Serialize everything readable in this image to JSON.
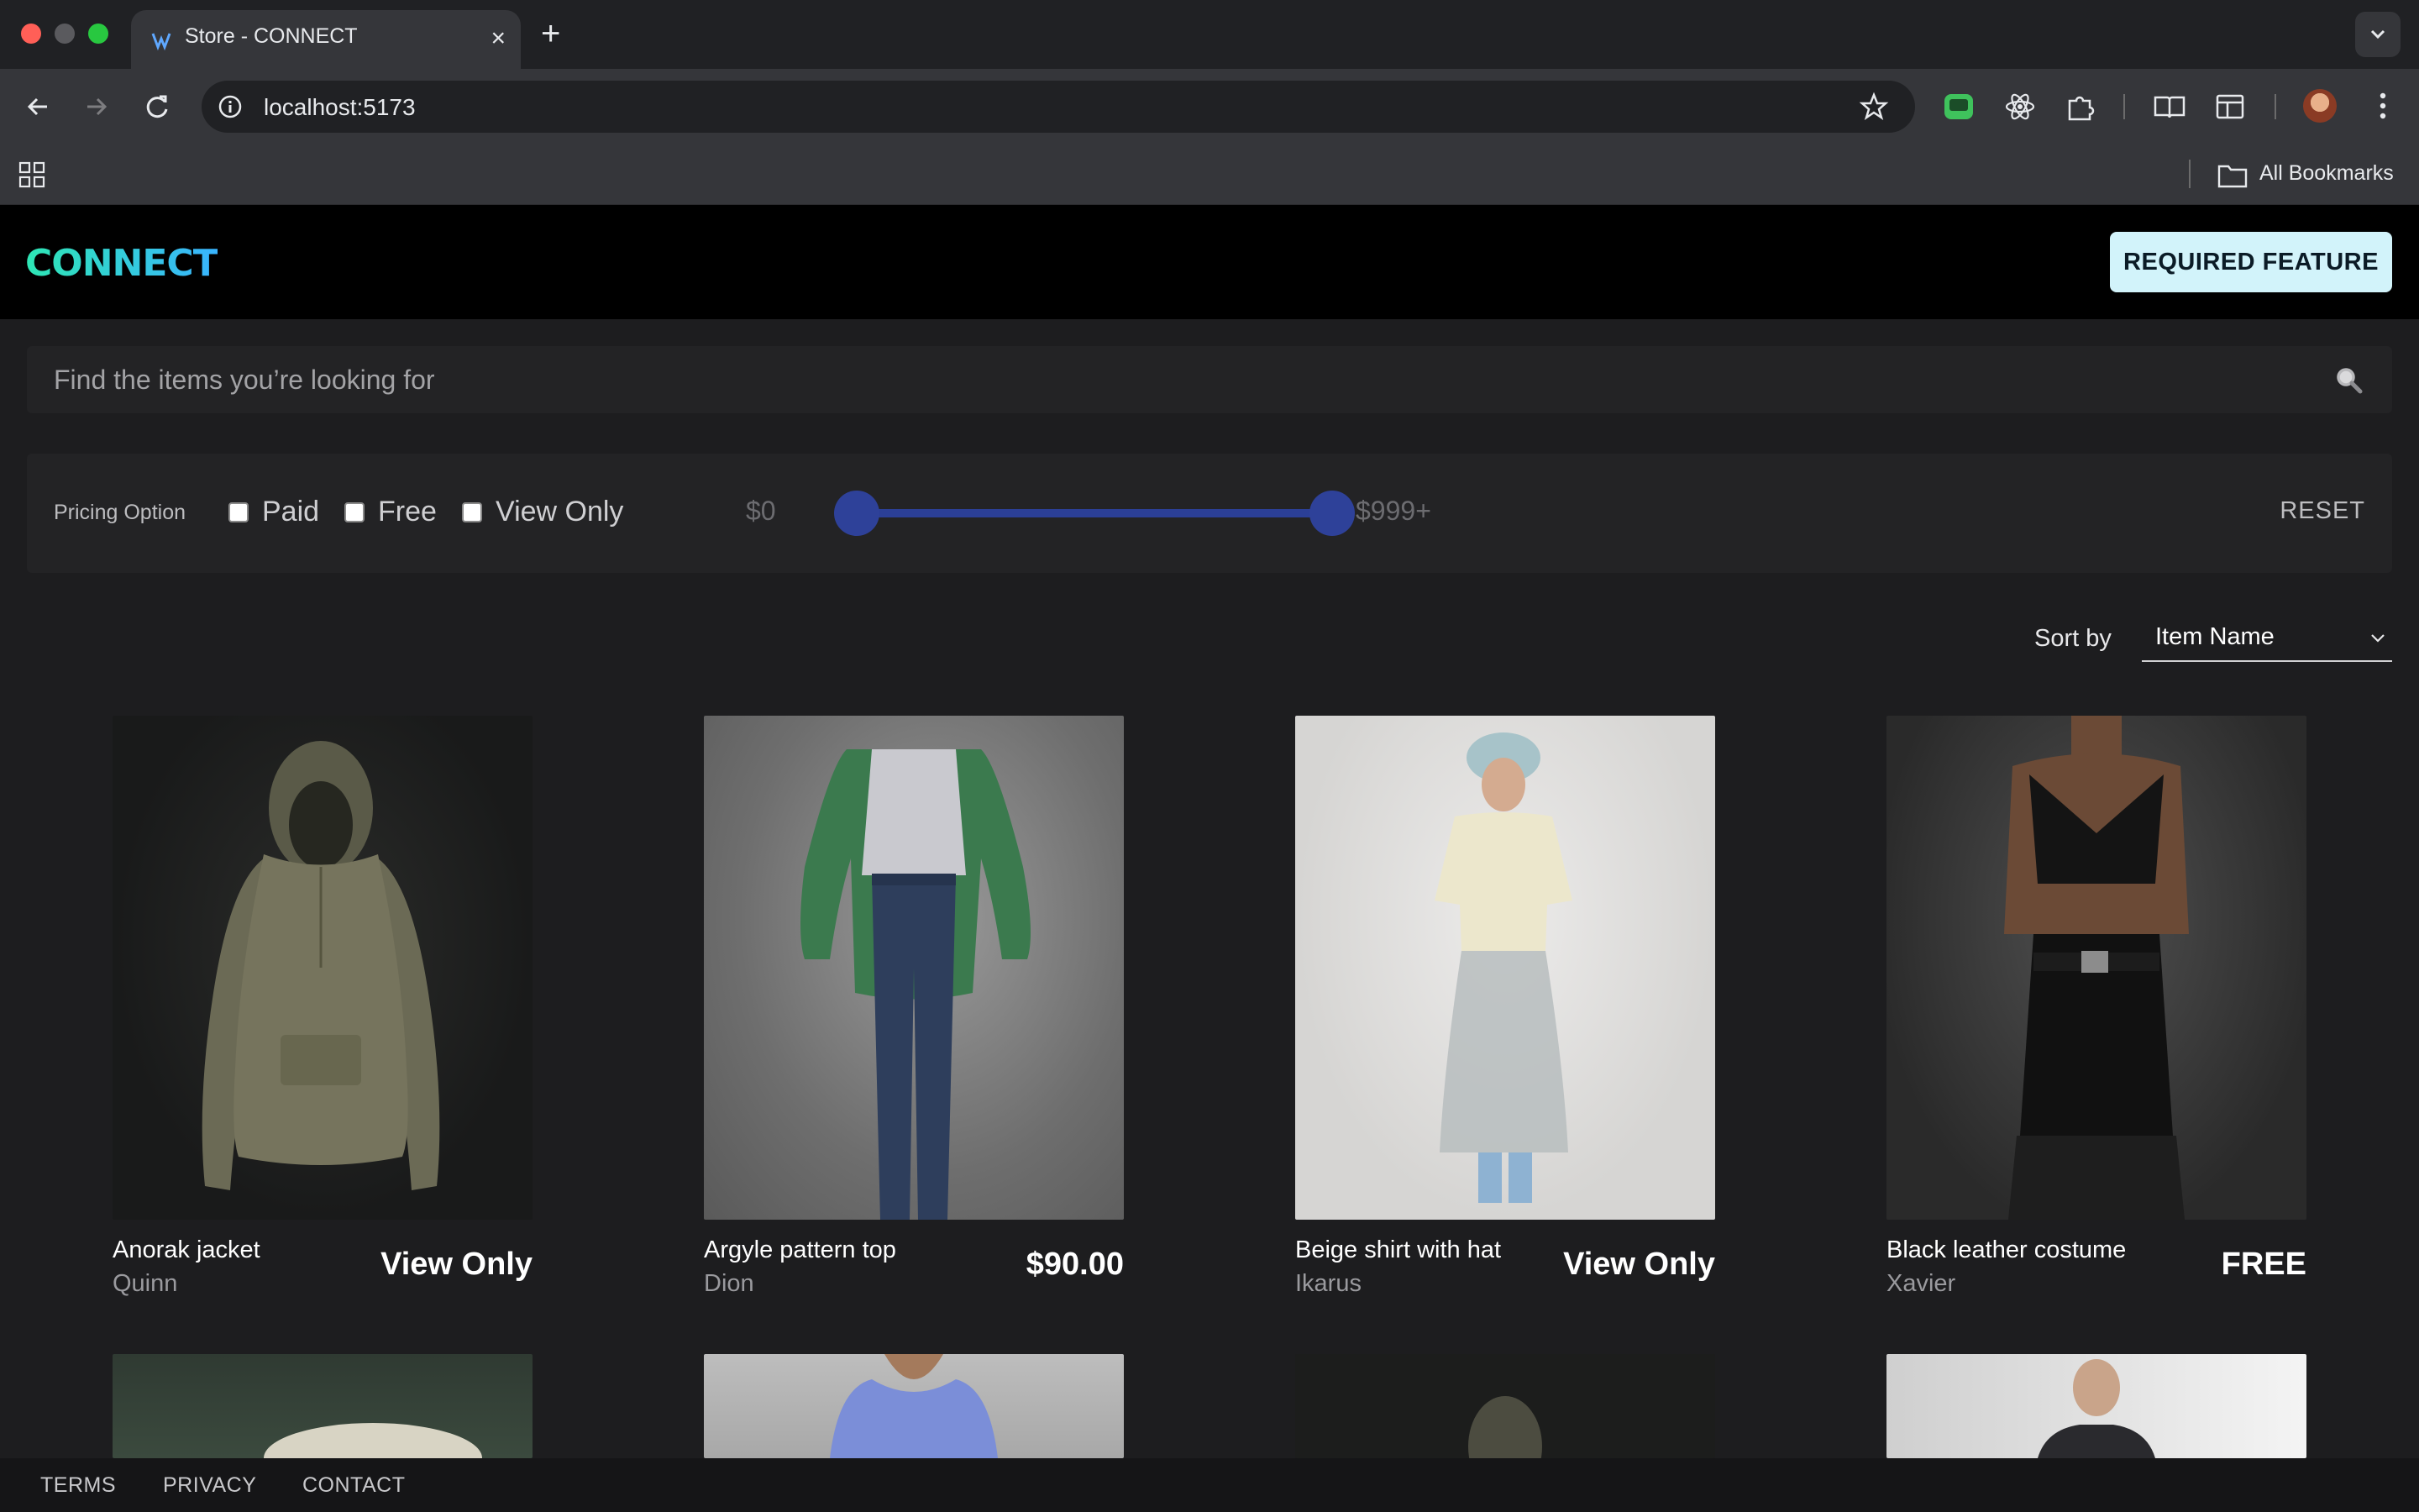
{
  "browser": {
    "tab_title": "Store - CONNECT",
    "tab_close": "×",
    "new_tab": "+",
    "url": "localhost:5173",
    "bookmarks_label": "All Bookmarks"
  },
  "header": {
    "logo": "CONNECT",
    "required_feature_label": "REQUIRED FEATURE"
  },
  "search": {
    "placeholder": "Find the items you’re looking for"
  },
  "filters": {
    "pricing_label": "Pricing Option",
    "options": [
      "Paid",
      "Free",
      "View Only"
    ],
    "price_min_label": "$0",
    "price_max_label": "$999+",
    "price_range_selected": [
      0,
      1
    ],
    "reset_label": "RESET"
  },
  "sort": {
    "label": "Sort by",
    "value": "Item Name"
  },
  "products": [
    {
      "name": "Anorak jacket",
      "creator": "Quinn",
      "price": "View Only",
      "image_icon": "anorak-jacket-image"
    },
    {
      "name": "Argyle pattern top",
      "creator": "Dion",
      "price": "$90.00",
      "image_icon": "argyle-top-image"
    },
    {
      "name": "Beige shirt with hat",
      "creator": "Ikarus",
      "price": "View Only",
      "image_icon": "beige-shirt-image"
    },
    {
      "name": "Black leather costume",
      "creator": "Xavier",
      "price": "FREE",
      "image_icon": "black-leather-image"
    }
  ],
  "footer": {
    "links": [
      "TERMS",
      "PRIVACY",
      "CONTACT"
    ]
  },
  "colors": {
    "page_bg": "#1d1d1f",
    "panel_bg": "#232325",
    "accent_button": "#d2f3fa",
    "slider": "#2e4199"
  }
}
